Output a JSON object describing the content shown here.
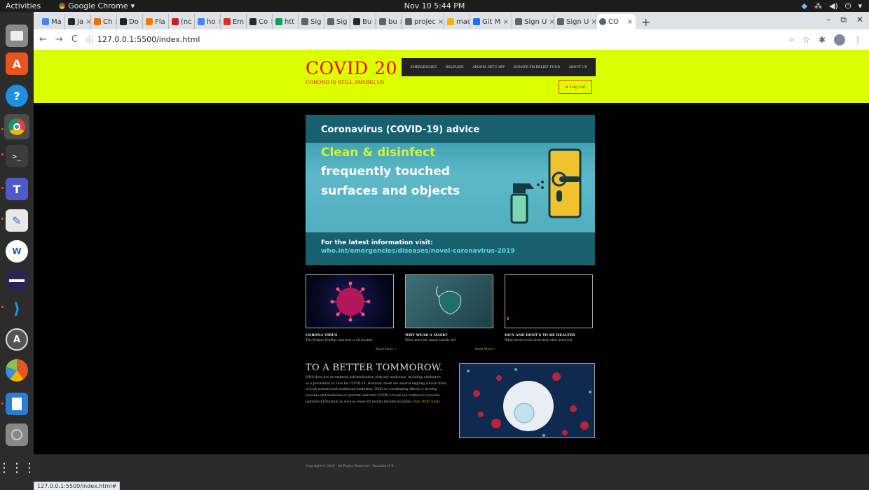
{
  "topbar": {
    "activities": "Activities",
    "app_name": "Google Chrome",
    "clock": "Nov 10  5:44 PM"
  },
  "browser": {
    "tabs": [
      {
        "label": "Ma",
        "fav_color": "#4285f4"
      },
      {
        "label": "Ja",
        "fav_color": "#24292e"
      },
      {
        "label": "Ch",
        "fav_color": "#e8710a"
      },
      {
        "label": "Do",
        "fav_color": "#202124"
      },
      {
        "label": "Fla",
        "fav_color": "#f57c00"
      },
      {
        "label": "(nc",
        "fav_color": "#c5221f"
      },
      {
        "label": "ho",
        "fav_color": "#4285f4"
      },
      {
        "label": "Em",
        "fav_color": "#d93025"
      },
      {
        "label": "Co",
        "fav_color": "#24292e"
      },
      {
        "label": "htt",
        "fav_color": "#0f9d58"
      },
      {
        "label": "Sig",
        "fav_color": "#5f6368"
      },
      {
        "label": "Sig",
        "fav_color": "#5f6368"
      },
      {
        "label": "Bu",
        "fav_color": "#24292e"
      },
      {
        "label": "bu",
        "fav_color": "#5f6368"
      },
      {
        "label": "projec",
        "fav_color": "#5f6368"
      },
      {
        "label": "maco",
        "fav_color": "#f4b400"
      },
      {
        "label": "Git M",
        "fav_color": "#1a73e8"
      },
      {
        "label": "Sign U",
        "fav_color": "#5f6368"
      },
      {
        "label": "Sign U",
        "fav_color": "#5f6368"
      }
    ],
    "active_tab": {
      "label": "CO"
    },
    "new_tab": "+",
    "url": "127.0.0.1:5500/index.html",
    "status_url": "127.0.0.1:5500/index.html#"
  },
  "site": {
    "title": "COVID 20",
    "tagline": "CORONO IS STILL AMONG US",
    "nav": [
      "EMERGENCIES",
      "HELPLINE",
      "AROGYA SETU APP",
      "DONATE PM RELIEF FUND",
      "ABOUT US"
    ],
    "logout": "Log out",
    "banner": {
      "heading": "Coronavirus (COVID-19) advice",
      "line1": "Clean & disinfect",
      "line2": "frequently touched",
      "line3": "surfaces and objects",
      "visit": "For the latest information visit:",
      "url": "who.int/emergencies/diseases/novel-coronavirus-2019"
    },
    "cards": [
      {
        "title": "CORONA VIRUS",
        "subtitle": "The Wuhan Prodigy and how it all started.",
        "read_more": "Read More »"
      },
      {
        "title": "WHY WEAR A MASK?",
        "subtitle": "What does the mask exactly do?",
        "read_more": "Read More »"
      },
      {
        "title": "DO'S AND DONT'S TO BE HEALTHY",
        "subtitle": "What needs to be done and what need not",
        "read_more": ""
      }
    ],
    "tomorrow": {
      "title": "TO A BETTER TOMMOROW.",
      "lines": [
        "WHO does not recommend self-medication with any medicines, including antibiotics,",
        "as a prevention or cure for COVID-19. However, there are several ongoing clinical trials",
        "of both western and traditional medicines. WHO is coordinating efforts to develop",
        "vaccines and medicines to prevent and treat COVID-19 and will continue to provide",
        "updated information as soon as research results become available."
      ],
      "link": "Visit WHO today"
    },
    "footer": "Copyright © 2020 - All Rights Reserved - Harshith H R"
  },
  "colors": {
    "header_bg": "#dcff00",
    "brand_red": "#ff0000",
    "nav_bg": "#222222",
    "page_bg": "#000000",
    "footer_bg": "#2b2b2b",
    "link_orange": "#e0a020"
  },
  "dock_icons": [
    "files-icon",
    "software-icon",
    "help-icon",
    "chrome-icon",
    "terminal-icon",
    "teams-icon",
    "text-editor-icon",
    "webstorm-icon",
    "eclipse-icon",
    "vscode-icon",
    "update-icon",
    "chart-icon",
    "writer-icon",
    "disc-icon",
    "apps-grid-icon"
  ]
}
